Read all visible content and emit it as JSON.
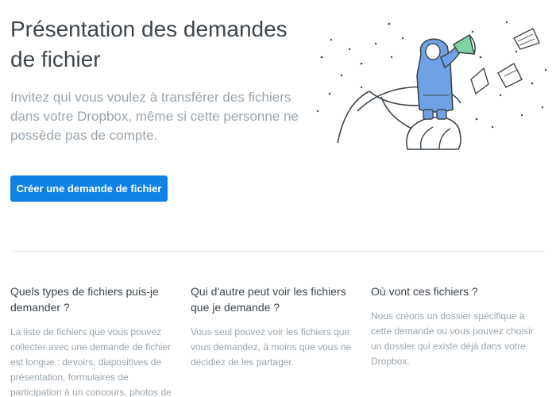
{
  "hero": {
    "title": "Présentation des demandes de fichier",
    "subtitle": "Invitez qui vous voulez à transférer des fichiers dans votre Dropbox, même si cette personne ne possède pas de compte.",
    "cta_label": "Créer une demande de fichier"
  },
  "illustration": {
    "icon": "person-with-megaphone-illustration"
  },
  "faq": [
    {
      "question": "Quels types de fichiers puis-je demander ?",
      "answer": "La liste de fichiers que vous pouvez collecter avec une demande de fichier est longue : devoirs, diapositives de présentation, formulaires de participation à un concours, photos de"
    },
    {
      "question": "Qui d'autre peut voir les fichiers que je demande ?",
      "answer": "Vous seul pouvez voir les fichiers que vous demandez, à moins que vous ne décidiez de les partager."
    },
    {
      "question": "Où vont ces fichiers ?",
      "answer": "Nous créons un dossier spécifique à cette demande ou vous pouvez choisir un dossier qui existe déjà dans votre Dropbox."
    }
  ],
  "colors": {
    "accent": "#0f82e6",
    "title": "#3d464d",
    "muted": "#9aa5ad",
    "coat": "#6fa1e4",
    "megaphone": "#7fd3a2"
  }
}
